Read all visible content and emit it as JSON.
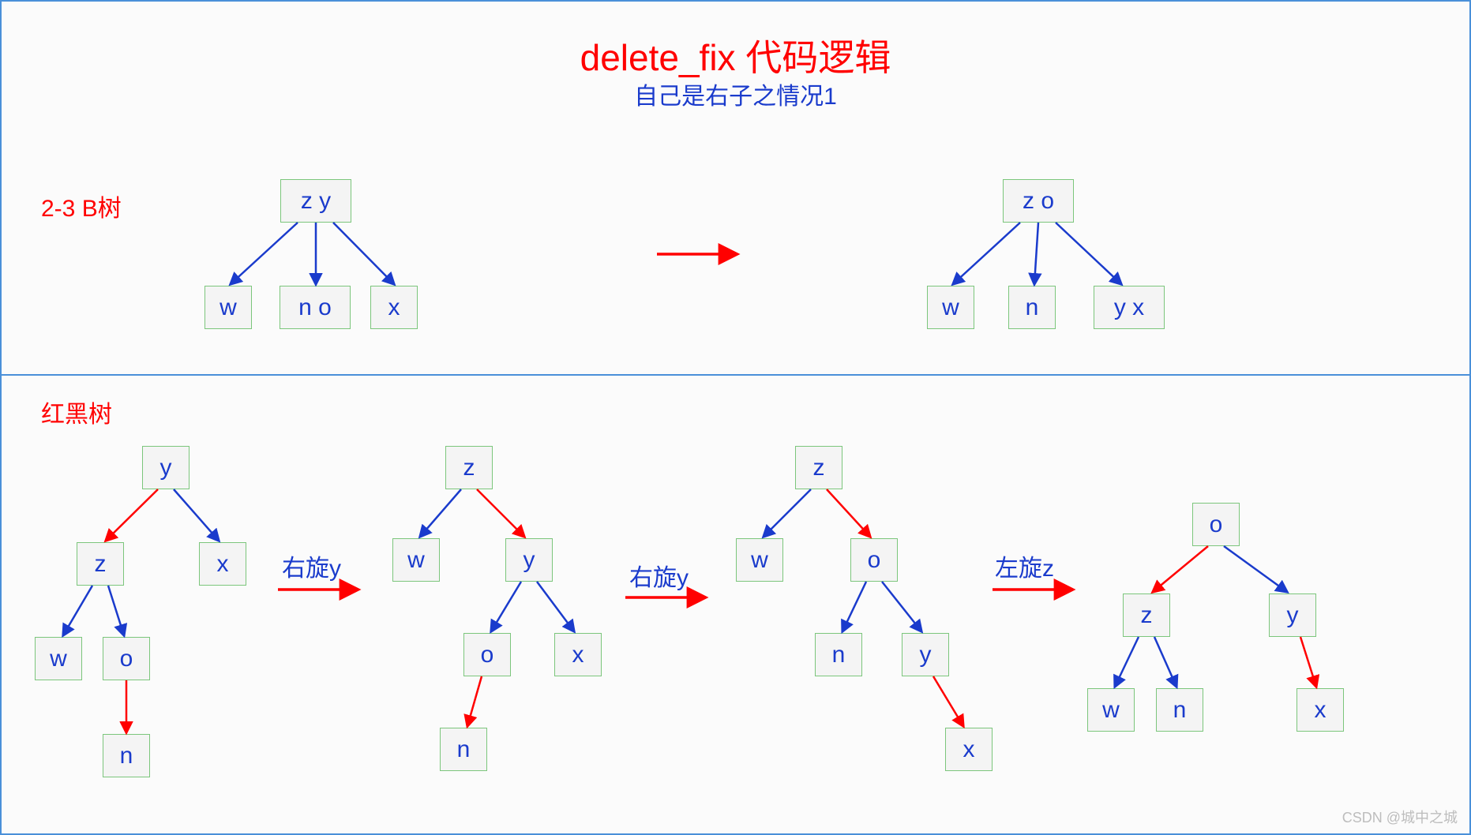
{
  "title": "delete_fix 代码逻辑",
  "subtitle": "自己是右子之情况1",
  "labels": {
    "btree": "2-3 B树",
    "rbtree": "红黑树",
    "rotR_y_1": "右旋y",
    "rotR_y_2": "右旋y",
    "rotL_z": "左旋z"
  },
  "btree": {
    "left": {
      "root": "z y",
      "c0": "w",
      "c1": "n o",
      "c2": "x"
    },
    "right": {
      "root": "z o",
      "c0": "w",
      "c1": "n",
      "c2": "y x"
    }
  },
  "rb": {
    "t1": {
      "y": "y",
      "z": "z",
      "x": "x",
      "w": "w",
      "o": "o",
      "n": "n"
    },
    "t2": {
      "z": "z",
      "w": "w",
      "y": "y",
      "o": "o",
      "x": "x",
      "n": "n"
    },
    "t3": {
      "z": "z",
      "w": "w",
      "o": "o",
      "n": "n",
      "y": "y",
      "x": "x"
    },
    "t4": {
      "o": "o",
      "z": "z",
      "y": "y",
      "w": "w",
      "n": "n",
      "x": "x"
    }
  },
  "watermark": "CSDN @城中之城",
  "colors": {
    "blue": "#1a3bcc",
    "red": "#ff0000"
  }
}
